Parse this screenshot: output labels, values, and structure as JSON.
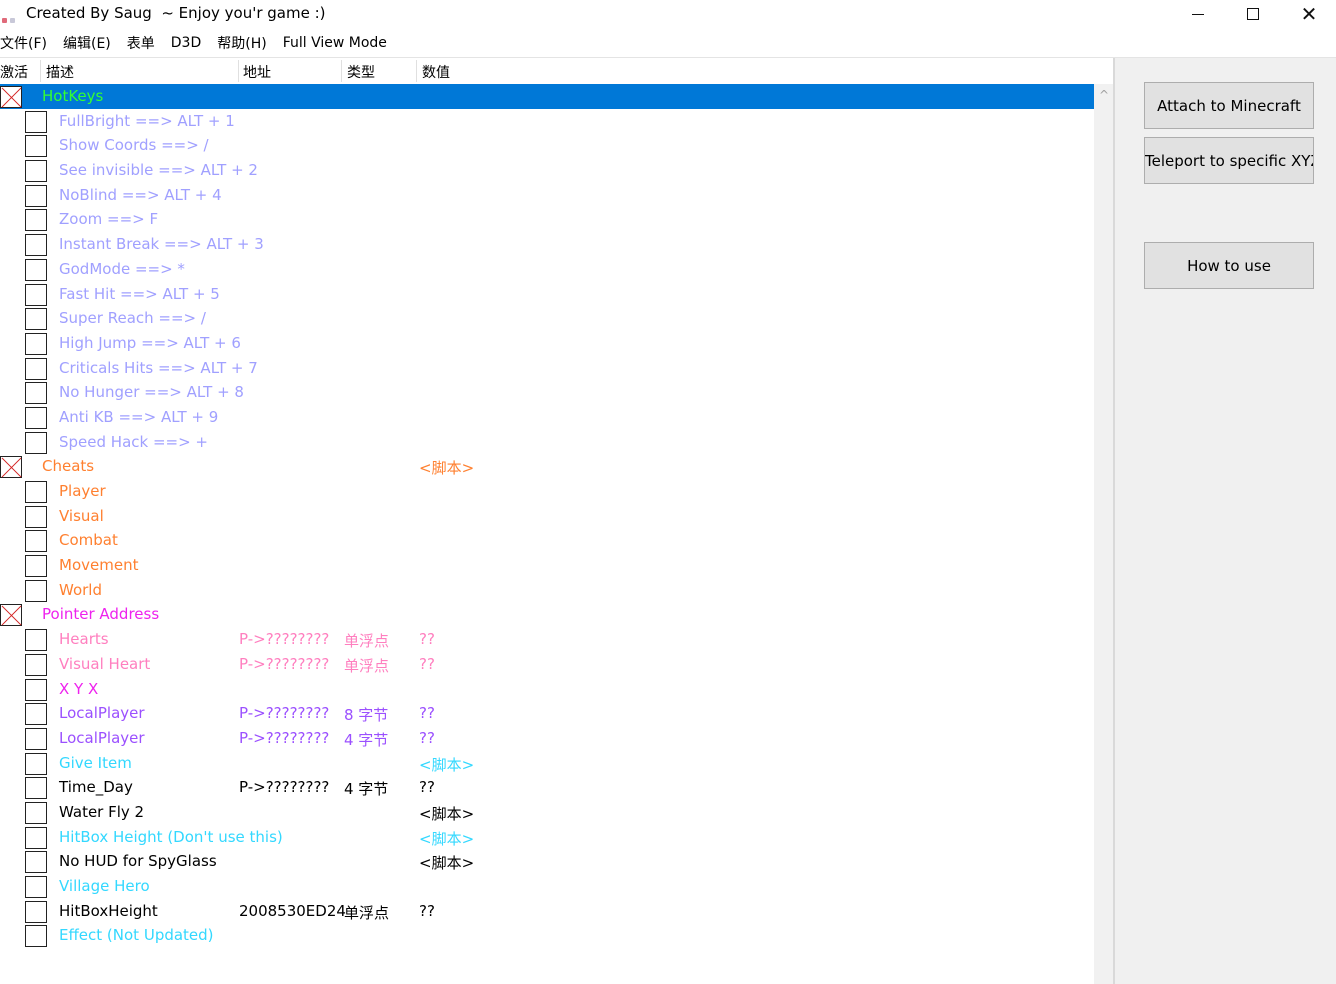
{
  "window": {
    "title": "Created By Saug  ~ Enjoy you'r game :)",
    "minimize": "─",
    "maximize": "☐",
    "close": "✕"
  },
  "menu": [
    "文件(F)",
    "编辑(E)",
    "表单",
    "D3D",
    "帮助(H)",
    "Full View Mode"
  ],
  "columns": {
    "active": "激活",
    "description": "描述",
    "address": "地址",
    "type": "类型",
    "value": "数值"
  },
  "colors": {
    "selection": "#0078d7",
    "hotkeys_group": "#33ff33",
    "hotkeys_item": "#a0a0ff",
    "cheats": "#ff8030",
    "pointer_group": "#ee22ee",
    "pointer_item": "#ff7fbf",
    "cyan": "#33d8ff",
    "default": "#000000"
  },
  "rows": [
    {
      "kind": "group",
      "checked": true,
      "desc": "HotKeys",
      "addr": "",
      "type": "",
      "val": "",
      "color": "#33ff33",
      "selected": true
    },
    {
      "kind": "item",
      "checked": false,
      "desc": "FullBright       ==> ALT + 1",
      "addr": "",
      "type": "",
      "val": "",
      "color": "#a0a0ff"
    },
    {
      "kind": "item",
      "checked": false,
      "desc": "Show Coords ==> /",
      "addr": "",
      "type": "",
      "val": "",
      "color": "#a0a0ff"
    },
    {
      "kind": "item",
      "checked": false,
      "desc": "See invisible   ==> ALT + 2",
      "addr": "",
      "type": "",
      "val": "",
      "color": "#a0a0ff"
    },
    {
      "kind": "item",
      "checked": false,
      "desc": "NoBlind          ==> ALT + 4",
      "addr": "",
      "type": "",
      "val": "",
      "color": "#a0a0ff"
    },
    {
      "kind": "item",
      "checked": false,
      "desc": "Zoom              ==> F",
      "addr": "",
      "type": "",
      "val": "",
      "color": "#a0a0ff"
    },
    {
      "kind": "item",
      "checked": false,
      "desc": "Instant Break  ==> ALT + 3",
      "addr": "",
      "type": "",
      "val": "",
      "color": "#a0a0ff"
    },
    {
      "kind": "item",
      "checked": false,
      "desc": "GodMode        ==> *",
      "addr": "",
      "type": "",
      "val": "",
      "color": "#a0a0ff"
    },
    {
      "kind": "item",
      "checked": false,
      "desc": "Fast Hit           ==> ALT + 5",
      "addr": "",
      "type": "",
      "val": "",
      "color": "#a0a0ff"
    },
    {
      "kind": "item",
      "checked": false,
      "desc": "Super Reach   ==> /",
      "addr": "",
      "type": "",
      "val": "",
      "color": "#a0a0ff"
    },
    {
      "kind": "item",
      "checked": false,
      "desc": "High Jump      ==> ALT + 6",
      "addr": "",
      "type": "",
      "val": "",
      "color": "#a0a0ff"
    },
    {
      "kind": "item",
      "checked": false,
      "desc": "Criticals Hits  ==> ALT + 7",
      "addr": "",
      "type": "",
      "val": "",
      "color": "#a0a0ff"
    },
    {
      "kind": "item",
      "checked": false,
      "desc": "No Hunger     ==> ALT + 8",
      "addr": "",
      "type": "",
      "val": "",
      "color": "#a0a0ff"
    },
    {
      "kind": "item",
      "checked": false,
      "desc": "Anti KB           ==> ALT + 9",
      "addr": "",
      "type": "",
      "val": "",
      "color": "#a0a0ff"
    },
    {
      "kind": "item",
      "checked": false,
      "desc": "Speed Hack  ==> +",
      "addr": "",
      "type": "",
      "val": "",
      "color": "#a0a0ff"
    },
    {
      "kind": "group",
      "checked": true,
      "desc": "Cheats",
      "addr": "",
      "type": "",
      "val": "<脚本>",
      "color": "#ff8030"
    },
    {
      "kind": "item",
      "checked": false,
      "desc": "Player",
      "addr": "",
      "type": "",
      "val": "",
      "color": "#ff8030"
    },
    {
      "kind": "item",
      "checked": false,
      "desc": "Visual",
      "addr": "",
      "type": "",
      "val": "",
      "color": "#ff8030"
    },
    {
      "kind": "item",
      "checked": false,
      "desc": "Combat",
      "addr": "",
      "type": "",
      "val": "",
      "color": "#ff8030"
    },
    {
      "kind": "item",
      "checked": false,
      "desc": "Movement",
      "addr": "",
      "type": "",
      "val": "",
      "color": "#ff8030"
    },
    {
      "kind": "item",
      "checked": false,
      "desc": "World",
      "addr": "",
      "type": "",
      "val": "",
      "color": "#ff8030"
    },
    {
      "kind": "group",
      "checked": true,
      "desc": "Pointer Address",
      "addr": "",
      "type": "",
      "val": "",
      "color": "#ee22ee"
    },
    {
      "kind": "item",
      "checked": false,
      "desc": "Hearts",
      "addr": "P->????????",
      "type": "单浮点",
      "val": "??",
      "color": "#ff7fbf"
    },
    {
      "kind": "item",
      "checked": false,
      "desc": "Visual Heart",
      "addr": "P->????????",
      "type": "单浮点",
      "val": "??",
      "color": "#ff7fbf"
    },
    {
      "kind": "item",
      "checked": false,
      "desc": "X Y X",
      "addr": "",
      "type": "",
      "val": "",
      "color": "#ee22ee"
    },
    {
      "kind": "item",
      "checked": false,
      "desc": "LocalPlayer",
      "addr": "P->????????",
      "type": "8 字节",
      "val": "??",
      "color": "#9b50ff"
    },
    {
      "kind": "item",
      "checked": false,
      "desc": "LocalPlayer",
      "addr": "P->????????",
      "type": "4 字节",
      "val": "??",
      "color": "#9b50ff"
    },
    {
      "kind": "item",
      "checked": false,
      "desc": "Give Item",
      "addr": "",
      "type": "",
      "val": "<脚本>",
      "color": "#33d8ff"
    },
    {
      "kind": "item",
      "checked": false,
      "desc": "Time_Day",
      "addr": "P->????????",
      "type": "4 字节",
      "val": "??",
      "color": "#000000"
    },
    {
      "kind": "item",
      "checked": false,
      "desc": "Water Fly 2",
      "addr": "",
      "type": "",
      "val": "<脚本>",
      "color": "#000000"
    },
    {
      "kind": "item",
      "checked": false,
      "desc": "HitBox Height (Don't use this)",
      "addr": "",
      "type": "",
      "val": "<脚本>",
      "color": "#33d8ff"
    },
    {
      "kind": "item",
      "checked": false,
      "desc": "No HUD for SpyGlass",
      "addr": "",
      "type": "",
      "val": "<脚本>",
      "color": "#000000"
    },
    {
      "kind": "item",
      "checked": false,
      "desc": "Village Hero",
      "addr": "",
      "type": "",
      "val": "",
      "color": "#33d8ff"
    },
    {
      "kind": "item",
      "checked": false,
      "desc": "HitBoxHeight",
      "addr": "2008530ED24",
      "type": "单浮点",
      "val": "??",
      "color": "#000000"
    },
    {
      "kind": "item",
      "checked": false,
      "desc": "Effect (Not Updated)",
      "addr": "",
      "type": "",
      "val": "",
      "color": "#33d8ff"
    }
  ],
  "buttons": {
    "attach": "Attach to Minecraft",
    "teleport": "Teleport to specific XYZ",
    "howto": "How to use"
  },
  "icons": {
    "app": "app-icon",
    "scroll_up": "chevron-up-icon"
  }
}
